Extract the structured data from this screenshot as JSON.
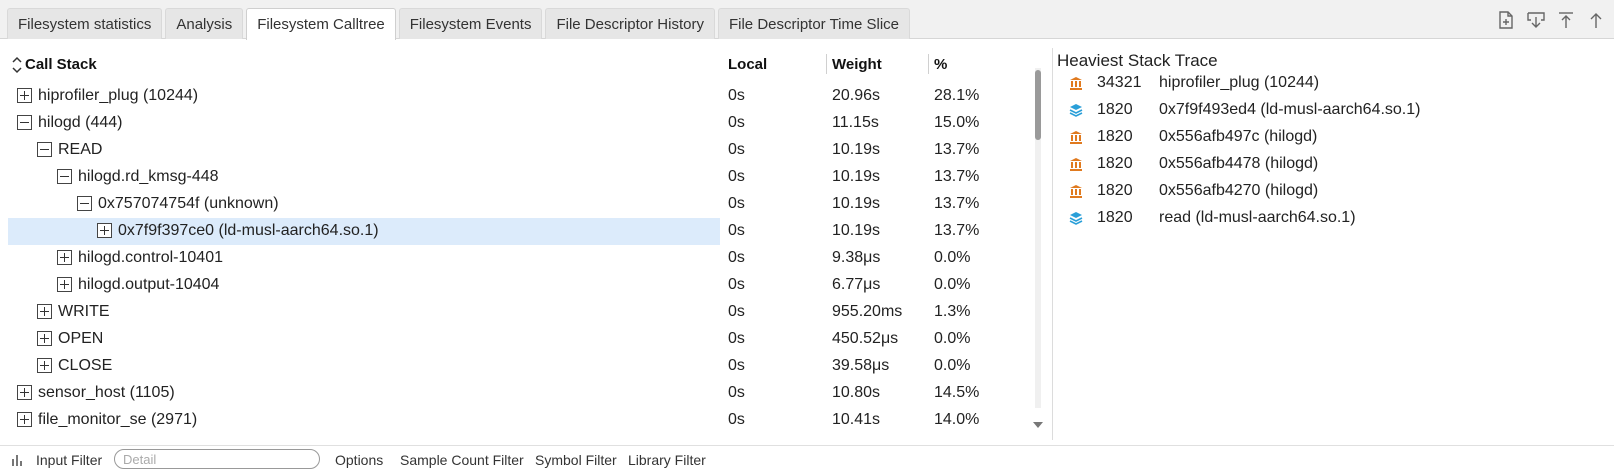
{
  "tabs": [
    {
      "label": "Filesystem statistics",
      "active": false
    },
    {
      "label": "Analysis",
      "active": false
    },
    {
      "label": "Filesystem Calltree",
      "active": true
    },
    {
      "label": "Filesystem Events",
      "active": false
    },
    {
      "label": "File Descriptor History",
      "active": false
    },
    {
      "label": "File Descriptor Time Slice",
      "active": false
    }
  ],
  "toolbar_icons": [
    "export-file-icon",
    "download-icon",
    "move-top-icon",
    "collapse-up-icon"
  ],
  "calltree": {
    "columns": {
      "call_stack": "Call Stack",
      "local": "Local",
      "weight": "Weight",
      "percent": "%"
    },
    "rows": [
      {
        "name": "hiprofiler_plug (10244)",
        "local": "0s",
        "weight": "20.96s",
        "percent": "28.1%",
        "depth": 0,
        "expanded": false,
        "selected": false
      },
      {
        "name": "hilogd (444)",
        "local": "0s",
        "weight": "11.15s",
        "percent": "15.0%",
        "depth": 0,
        "expanded": true,
        "selected": false
      },
      {
        "name": "READ",
        "local": "0s",
        "weight": "10.19s",
        "percent": "13.7%",
        "depth": 1,
        "expanded": true,
        "selected": false
      },
      {
        "name": "hilogd.rd_kmsg-448",
        "local": "0s",
        "weight": "10.19s",
        "percent": "13.7%",
        "depth": 2,
        "expanded": true,
        "selected": false
      },
      {
        "name": "0x757074754f (unknown)",
        "local": "0s",
        "weight": "10.19s",
        "percent": "13.7%",
        "depth": 3,
        "expanded": true,
        "selected": false
      },
      {
        "name": "0x7f9f397ce0 (ld-musl-aarch64.so.1)",
        "local": "0s",
        "weight": "10.19s",
        "percent": "13.7%",
        "depth": 4,
        "expanded": false,
        "selected": true
      },
      {
        "name": "hilogd.control-10401",
        "local": "0s",
        "weight": "9.38μs",
        "percent": "0.0%",
        "depth": 2,
        "expanded": false,
        "selected": false
      },
      {
        "name": "hilogd.output-10404",
        "local": "0s",
        "weight": "6.77μs",
        "percent": "0.0%",
        "depth": 2,
        "expanded": false,
        "selected": false
      },
      {
        "name": "WRITE",
        "local": "0s",
        "weight": "955.20ms",
        "percent": "1.3%",
        "depth": 1,
        "expanded": false,
        "selected": false
      },
      {
        "name": "OPEN",
        "local": "0s",
        "weight": "450.52μs",
        "percent": "0.0%",
        "depth": 1,
        "expanded": false,
        "selected": false
      },
      {
        "name": "CLOSE",
        "local": "0s",
        "weight": "39.58μs",
        "percent": "0.0%",
        "depth": 1,
        "expanded": false,
        "selected": false
      },
      {
        "name": "sensor_host (1105)",
        "local": "0s",
        "weight": "10.80s",
        "percent": "14.5%",
        "depth": 0,
        "expanded": false,
        "selected": false
      },
      {
        "name": "file_monitor_se (2971)",
        "local": "0s",
        "weight": "10.41s",
        "percent": "14.0%",
        "depth": 0,
        "expanded": false,
        "selected": false
      }
    ]
  },
  "heaviest": {
    "title": "Heaviest Stack Trace",
    "items": [
      {
        "count": "34321",
        "name": "hiprofiler_plug (10244)",
        "icon": "thread-icon",
        "color": "#e07a1f"
      },
      {
        "count": "1820",
        "name": "0x7f9f493ed4 (ld-musl-aarch64.so.1)",
        "icon": "library-icon",
        "color": "#2a9fd8"
      },
      {
        "count": "1820",
        "name": "0x556afb497c (hilogd)",
        "icon": "thread-icon",
        "color": "#e07a1f"
      },
      {
        "count": "1820",
        "name": "0x556afb4478 (hilogd)",
        "icon": "thread-icon",
        "color": "#e07a1f"
      },
      {
        "count": "1820",
        "name": "0x556afb4270 (hilogd)",
        "icon": "thread-icon",
        "color": "#e07a1f"
      },
      {
        "count": "1820",
        "name": "read (ld-musl-aarch64.so.1)",
        "icon": "library-icon",
        "color": "#2a9fd8"
      }
    ]
  },
  "filters": {
    "input_filter_label": "Input Filter",
    "detail_placeholder": "Detail",
    "options_label": "Options",
    "sample_count_label": "Sample Count Filter",
    "symbol_label": "Symbol Filter",
    "library_label": "Library Filter"
  }
}
